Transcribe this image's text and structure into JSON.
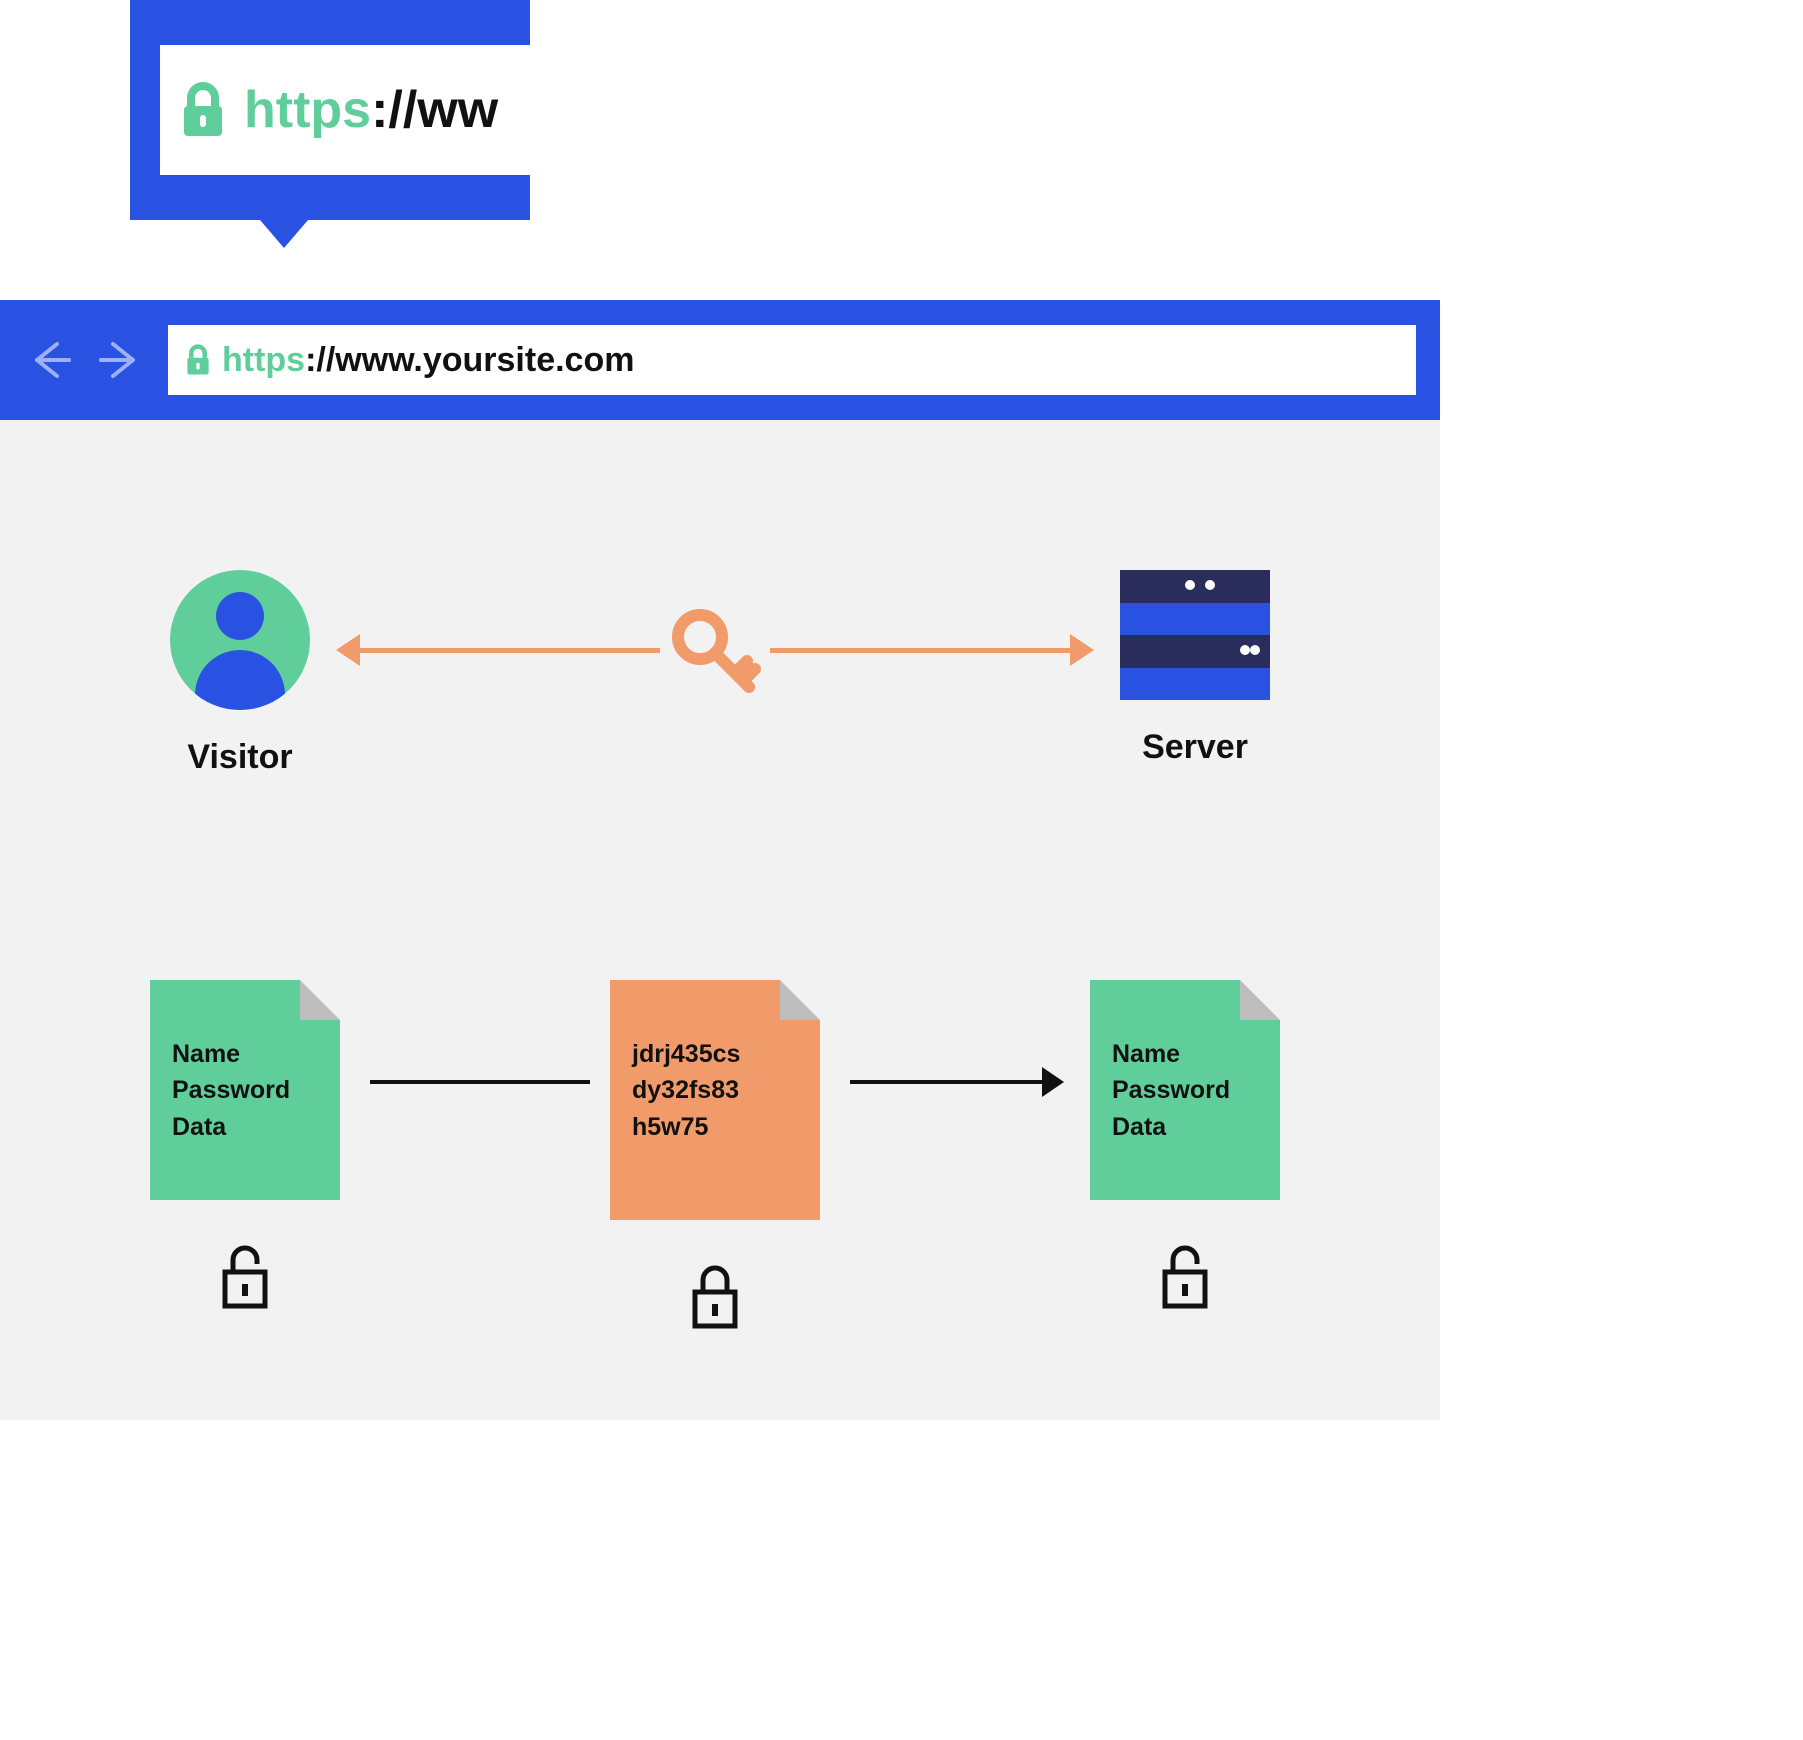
{
  "callout": {
    "https_label": "https",
    "url_fragment": "://ww"
  },
  "browser": {
    "https_label": "https",
    "url_rest": "://www.yoursite.com"
  },
  "diagram": {
    "visitor_label": "Visitor",
    "server_label": "Server",
    "doc_plain": {
      "line1": "Name",
      "line2": "Password",
      "line3": "Data"
    },
    "doc_encrypted": {
      "line1": "jdrj435cs",
      "line2": "dy32fs83",
      "line3": "h5w75"
    }
  }
}
